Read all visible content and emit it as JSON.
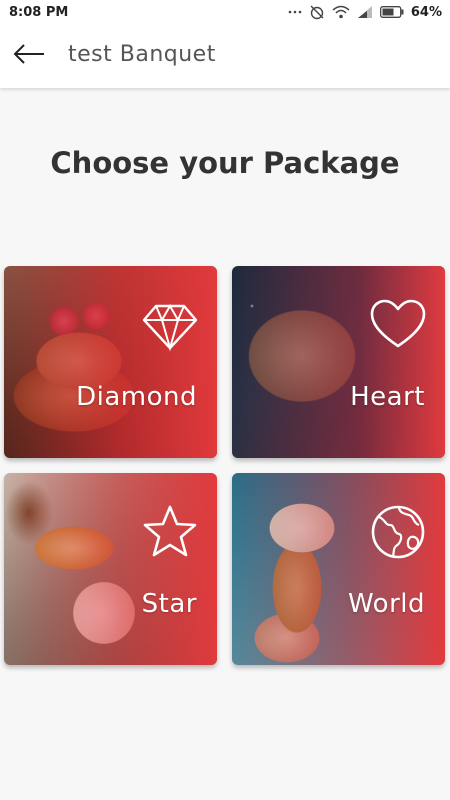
{
  "status_bar": {
    "time": "8:08 PM",
    "battery": "64%",
    "icons": [
      "dots-icon",
      "alarm-off-icon",
      "wifi-icon",
      "signal-icon",
      "battery-icon"
    ]
  },
  "app_bar": {
    "back_icon": "arrow-left-icon",
    "title": "test Banquet"
  },
  "heading": "Choose your Package",
  "packages": [
    {
      "label": "Diamond",
      "icon": "diamond-icon"
    },
    {
      "label": "Heart",
      "icon": "heart-icon"
    },
    {
      "label": "Star",
      "icon": "star-icon"
    },
    {
      "label": "World",
      "icon": "globe-icon"
    }
  ],
  "colors": {
    "accent": "#e13a3d",
    "background": "#f7f7f7",
    "heading": "#333333"
  }
}
